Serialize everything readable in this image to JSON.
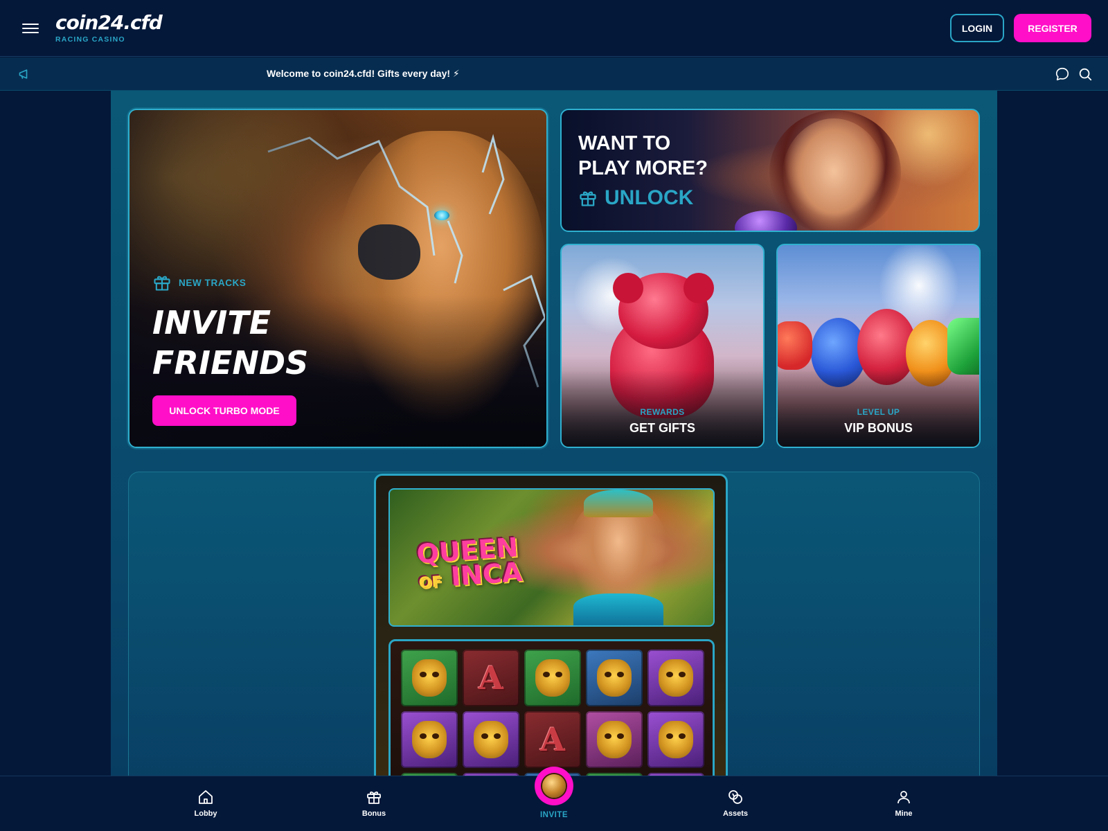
{
  "header": {
    "logo": "coin24.cfd",
    "logo_subtitle": "RACING CASINO",
    "login_label": "LOGIN",
    "register_label": "REGISTER"
  },
  "announcement": {
    "message": "Welcome to coin24.cfd! Gifts every day! ⚡"
  },
  "hero": {
    "tag": "NEW TRACKS",
    "title_line1": "INVITE",
    "title_line2": "FRIENDS",
    "cta": "UNLOCK TURBO MODE"
  },
  "promo": {
    "title_line1": "WANT TO",
    "title_line2": "PLAY MORE?",
    "unlock": "UNLOCK"
  },
  "tiles": [
    {
      "subtitle": "REWARDS",
      "title": "GET GIFTS"
    },
    {
      "subtitle": "LEVEL UP",
      "title": "VIP BONUS"
    }
  ],
  "game": {
    "logo_line1": "QUEEN",
    "logo_of": "OF",
    "logo_line2": "INCA",
    "reels": [
      [
        "green",
        "A",
        "green",
        "blue",
        "purple"
      ],
      [
        "purple",
        "purple",
        "A",
        "multi",
        "purple"
      ],
      [
        "green",
        "purple",
        "blue",
        "green",
        "purple"
      ]
    ]
  },
  "bottom_nav": {
    "lobby": "Lobby",
    "bonus": "Bonus",
    "invite": "INVITE",
    "assets": "Assets",
    "mine": "Mine"
  },
  "colors": {
    "background": "#04183a",
    "accent_pink": "#ff0fc8",
    "accent_cyan": "#2aa6c6",
    "panel": "#0a5876"
  }
}
